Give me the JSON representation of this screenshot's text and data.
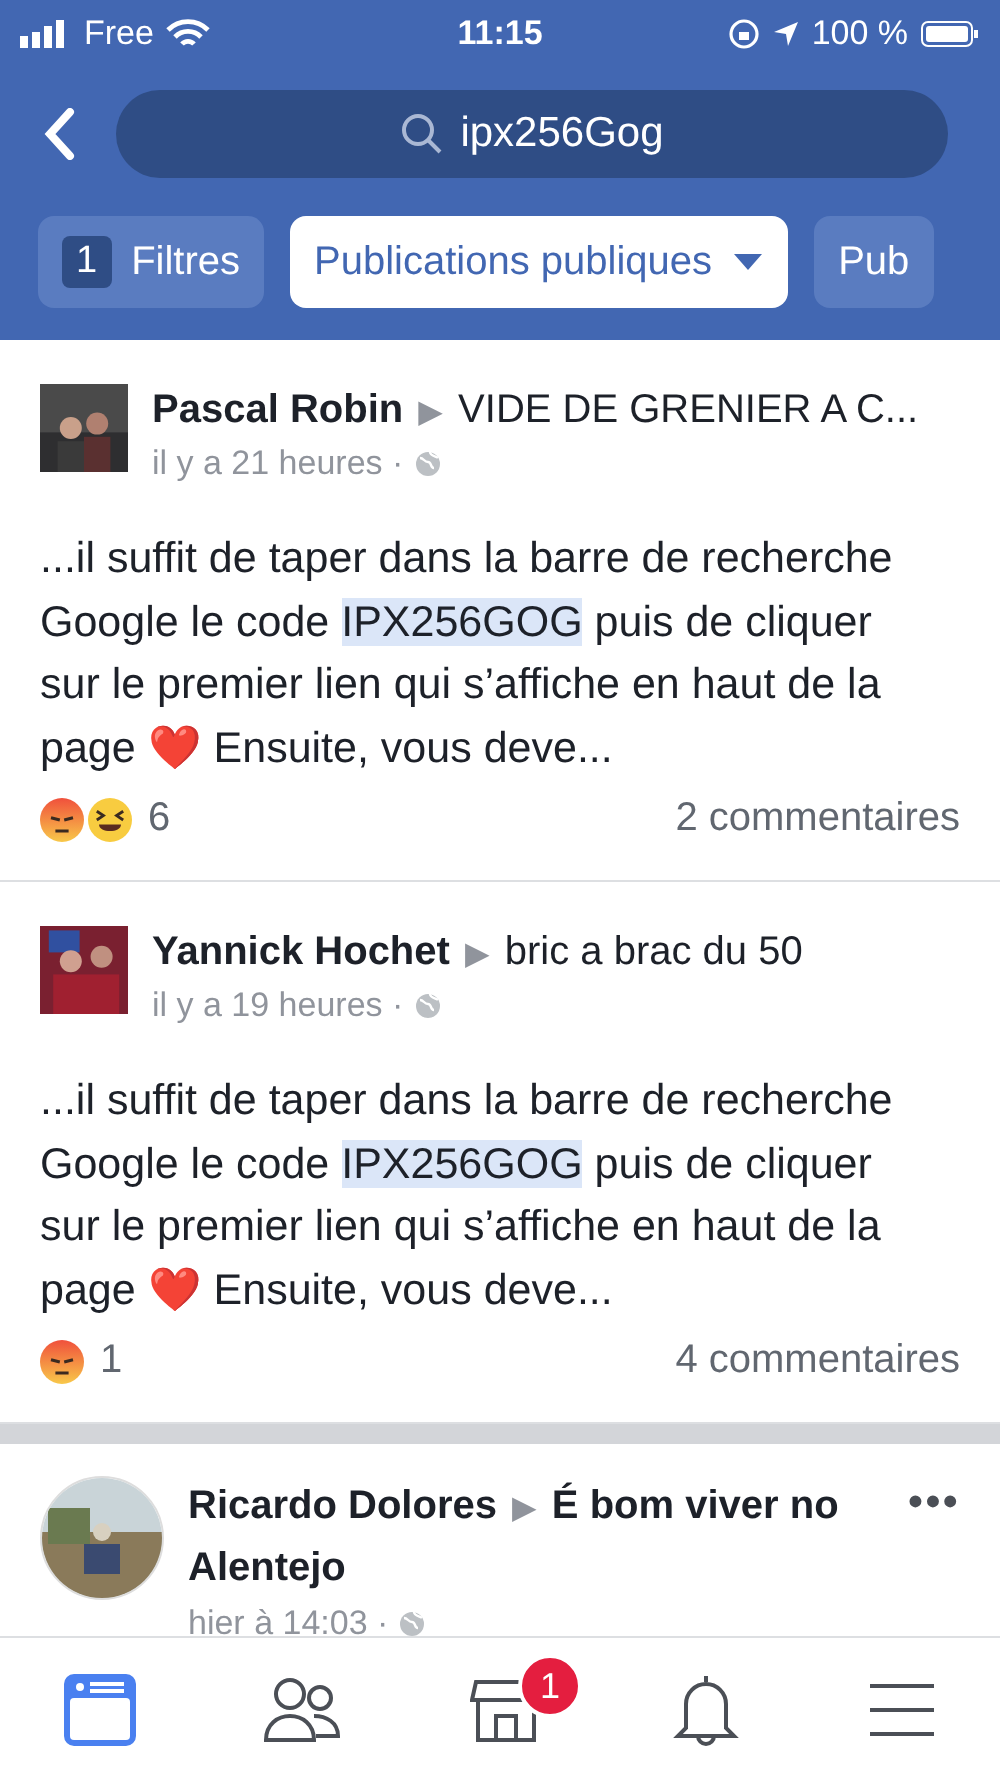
{
  "status_bar": {
    "carrier": "Free",
    "time": "11:15",
    "battery": "100 %"
  },
  "search": {
    "value": "ipx256Gog"
  },
  "filter_chips": [
    {
      "kind": "filters",
      "count": "1",
      "label": "Filtres",
      "selected": false
    },
    {
      "kind": "dropdown",
      "label": "Publications publiques",
      "selected": true
    },
    {
      "kind": "plain",
      "label": "Pub",
      "selected": false
    }
  ],
  "posts": [
    {
      "author": "Pascal Robin",
      "arrow": "▶",
      "target": "VIDE DE GRENIER A C...",
      "time": "il y a 21 heures ·",
      "avatar": {
        "kind": "square"
      },
      "body": [
        {
          "text": "...il suffit de taper dans la barre de recherche Google le code ",
          "highlight": false
        },
        {
          "text": "IPX256GOG",
          "highlight": true
        },
        {
          "text": " puis de cliquer sur le premier lien qui s’affiche en haut de la page ❤️ Ensuite, vous deve...",
          "highlight": false
        }
      ],
      "reactions": [
        {
          "kind": "angry"
        },
        {
          "kind": "haha"
        }
      ],
      "reaction_count": "6",
      "comments": "2 commentaires"
    },
    {
      "author": "Yannick Hochet",
      "arrow": "▶",
      "target": "bric a brac du 50",
      "time": "il y a 19 heures ·",
      "avatar": {
        "kind": "square"
      },
      "body": [
        {
          "text": "...il suffit de taper dans la barre de recherche Google le code ",
          "highlight": false
        },
        {
          "text": "IPX256GOG",
          "highlight": true
        },
        {
          "text": " puis de cliquer sur le premier lien qui s’affiche en haut de la page ❤️ Ensuite, vous deve...",
          "highlight": false
        }
      ],
      "reactions": [
        {
          "kind": "angry"
        }
      ],
      "reaction_count": "1",
      "comments": "4 commentaires"
    },
    {
      "author": "Ricardo Dolores",
      "arrow": "▶",
      "target": "É bom viver no Alentejo",
      "time": "hier à 14:03 ·",
      "avatar": {
        "kind": "round"
      },
      "more": "•••"
    }
  ],
  "tab_bar": [
    {
      "kind": "feed",
      "selected": true
    },
    {
      "kind": "friends",
      "selected": false
    },
    {
      "kind": "marketplace",
      "selected": false,
      "badge": "1"
    },
    {
      "kind": "notifications",
      "selected": false
    },
    {
      "kind": "menu",
      "selected": false
    }
  ]
}
